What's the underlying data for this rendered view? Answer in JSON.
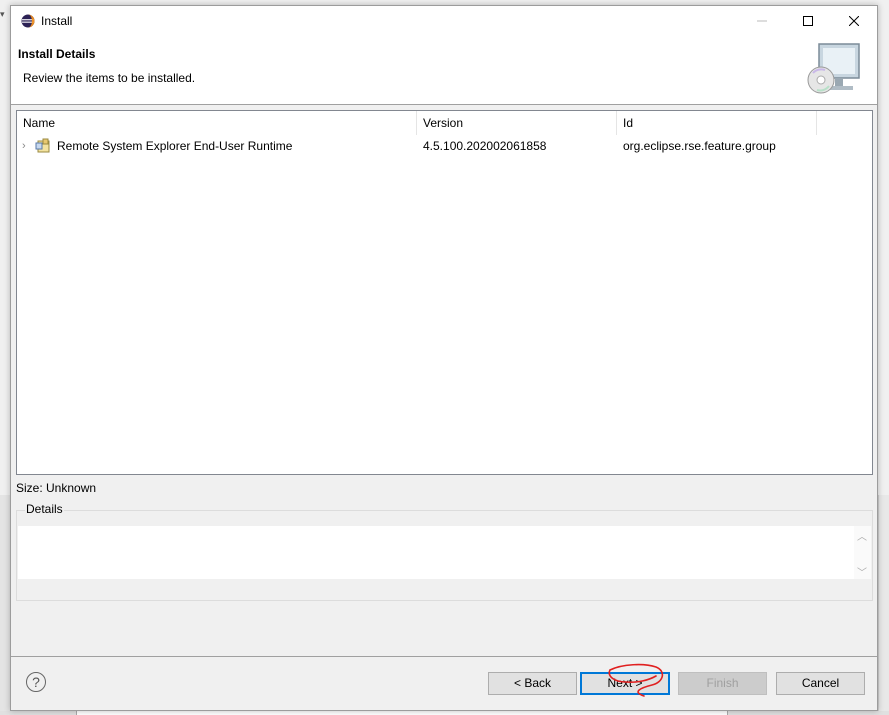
{
  "window": {
    "title": "Install",
    "minimize_icon": "minimize-icon",
    "maximize_icon": "maximize-icon",
    "close_icon": "close-icon"
  },
  "header": {
    "title": "Install Details",
    "subtitle": "Review the items to be installed."
  },
  "table": {
    "columns": [
      "Name",
      "Version",
      "Id"
    ],
    "rows": [
      {
        "name": "Remote System Explorer End-User Runtime",
        "version": "4.5.100.202002061858",
        "id": "org.eclipse.rse.feature.group"
      }
    ]
  },
  "size_label": "Size: Unknown",
  "details": {
    "label": "Details",
    "text": ""
  },
  "buttons": {
    "back": "< Back",
    "next": "Next >",
    "finish": "Finish",
    "cancel": "Cancel",
    "help": "?"
  },
  "colors": {
    "accent": "#0078d7",
    "annotation": "#e02020"
  }
}
